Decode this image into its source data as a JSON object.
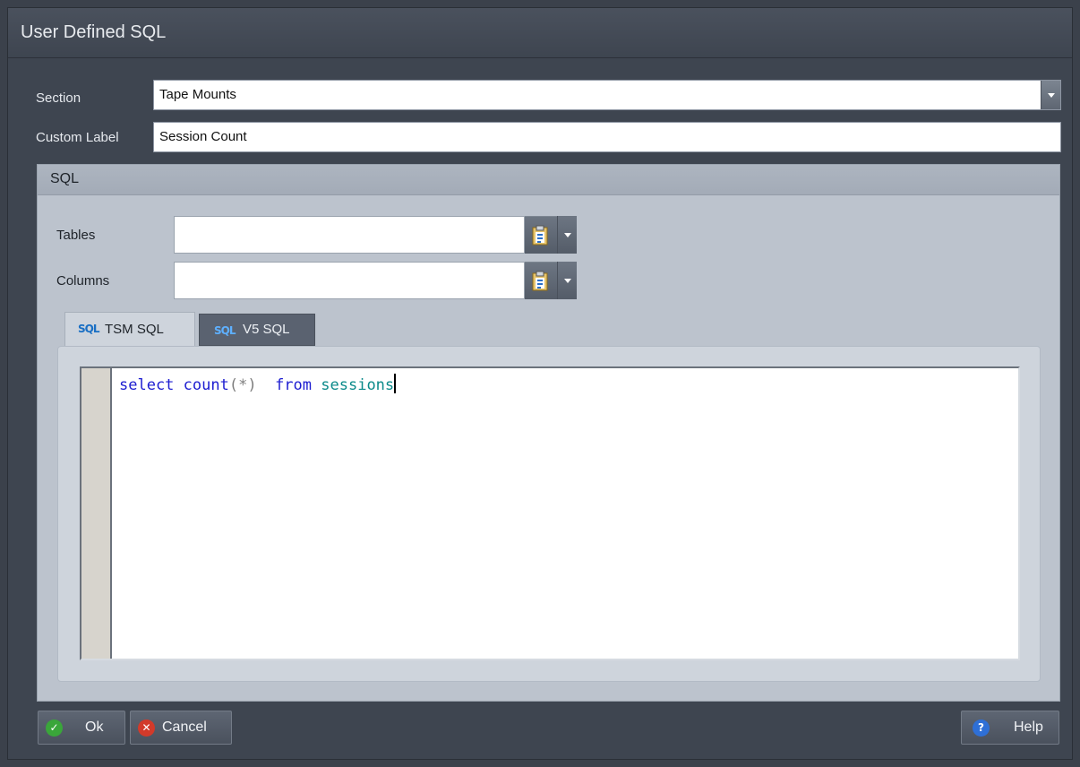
{
  "window": {
    "title": "User Defined SQL"
  },
  "form": {
    "section_label": "Section",
    "section_value": "Tape Mounts",
    "custom_label_label": "Custom Label",
    "custom_label_value": "Session Count"
  },
  "sql_group": {
    "header": "SQL",
    "tables_label": "Tables",
    "tables_value": "",
    "columns_label": "Columns",
    "columns_value": "",
    "tabs": [
      {
        "icon": "SQL",
        "label": "TSM SQL",
        "active": true
      },
      {
        "icon": "SQL",
        "label": "V5 SQL",
        "active": false
      }
    ],
    "editor": {
      "tokens": [
        {
          "text": "select",
          "type": "keyword"
        },
        {
          "text": " ",
          "type": "space"
        },
        {
          "text": "count",
          "type": "keyword"
        },
        {
          "text": "(*)",
          "type": "punct"
        },
        {
          "text": "  ",
          "type": "space"
        },
        {
          "text": "from",
          "type": "keyword"
        },
        {
          "text": " ",
          "type": "space"
        },
        {
          "text": "sessions",
          "type": "identifier"
        }
      ]
    }
  },
  "buttons": {
    "ok": "Ok",
    "cancel": "Cancel",
    "help": "Help"
  },
  "colors": {
    "keyword": "#1d1dd1",
    "identifier": "#0b8a8a",
    "punct": "#7e7e7e",
    "ok_icon": "#3aa63a",
    "cancel_icon": "#d23a2a",
    "help_icon": "#2e6fd6"
  }
}
